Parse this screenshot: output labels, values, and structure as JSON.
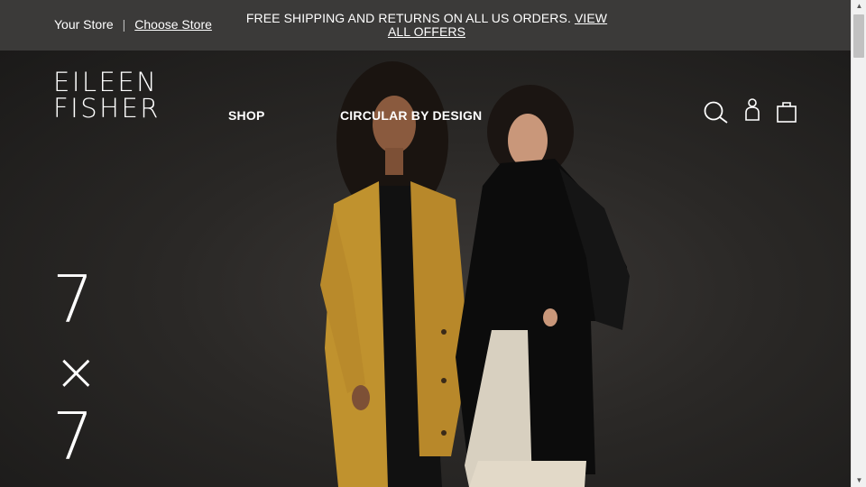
{
  "topbar": {
    "your_store": "Your Store",
    "separator": "|",
    "choose_store": "Choose Store",
    "promo_text": "FREE SHIPPING AND RETURNS ON ALL US ORDERS.",
    "promo_link": "VIEW ALL OFFERS"
  },
  "header": {
    "logo_line1": "EILEEN",
    "logo_line2": "FISHER",
    "nav": [
      "SHOP",
      "CIRCULAR BY DESIGN"
    ],
    "icons": [
      "search-icon",
      "account-icon",
      "bag-icon"
    ]
  },
  "hero": {
    "line1": "7",
    "line2": "×",
    "line3": "7"
  },
  "colors": {
    "topbar_bg": "#3b3a39",
    "hero_bg": "#2a2826",
    "text": "#ffffff",
    "mustard": "#c0922e"
  }
}
